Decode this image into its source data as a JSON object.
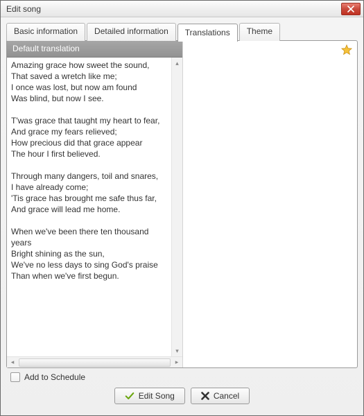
{
  "window": {
    "title": "Edit song"
  },
  "tabs": [
    {
      "label": "Basic information"
    },
    {
      "label": "Detailed information"
    },
    {
      "label": "Translations",
      "active": true
    },
    {
      "label": "Theme"
    }
  ],
  "translations": {
    "header": "Default translation",
    "lyrics": "Amazing grace how sweet the sound,\nThat saved a wretch like me;\nI once was lost, but now am found\nWas blind, but now I see.\n\nT'was grace that taught my heart to fear,\nAnd grace my fears relieved;\nHow precious did that grace appear\nThe hour I first believed.\n\nThrough many dangers, toil and snares,\nI have already come;\n'Tis grace has brought me safe thus far,\nAnd grace will lead me home.\n\nWhen we've been there ten thousand years\nBright shining as the sun,\nWe've no less days to sing God's praise\nThan when we've first begun."
  },
  "footer": {
    "add_to_schedule_label": "Add to Schedule",
    "edit_song_label": "Edit Song",
    "cancel_label": "Cancel"
  },
  "icons": {
    "close": "close-icon",
    "star": "star-icon",
    "check": "check-icon",
    "cross": "cross-icon"
  },
  "colors": {
    "star_fill": "#f6c23a",
    "star_stroke": "#c98f13",
    "check_stroke": "#6aa50e",
    "cross_fill": "#333333"
  }
}
